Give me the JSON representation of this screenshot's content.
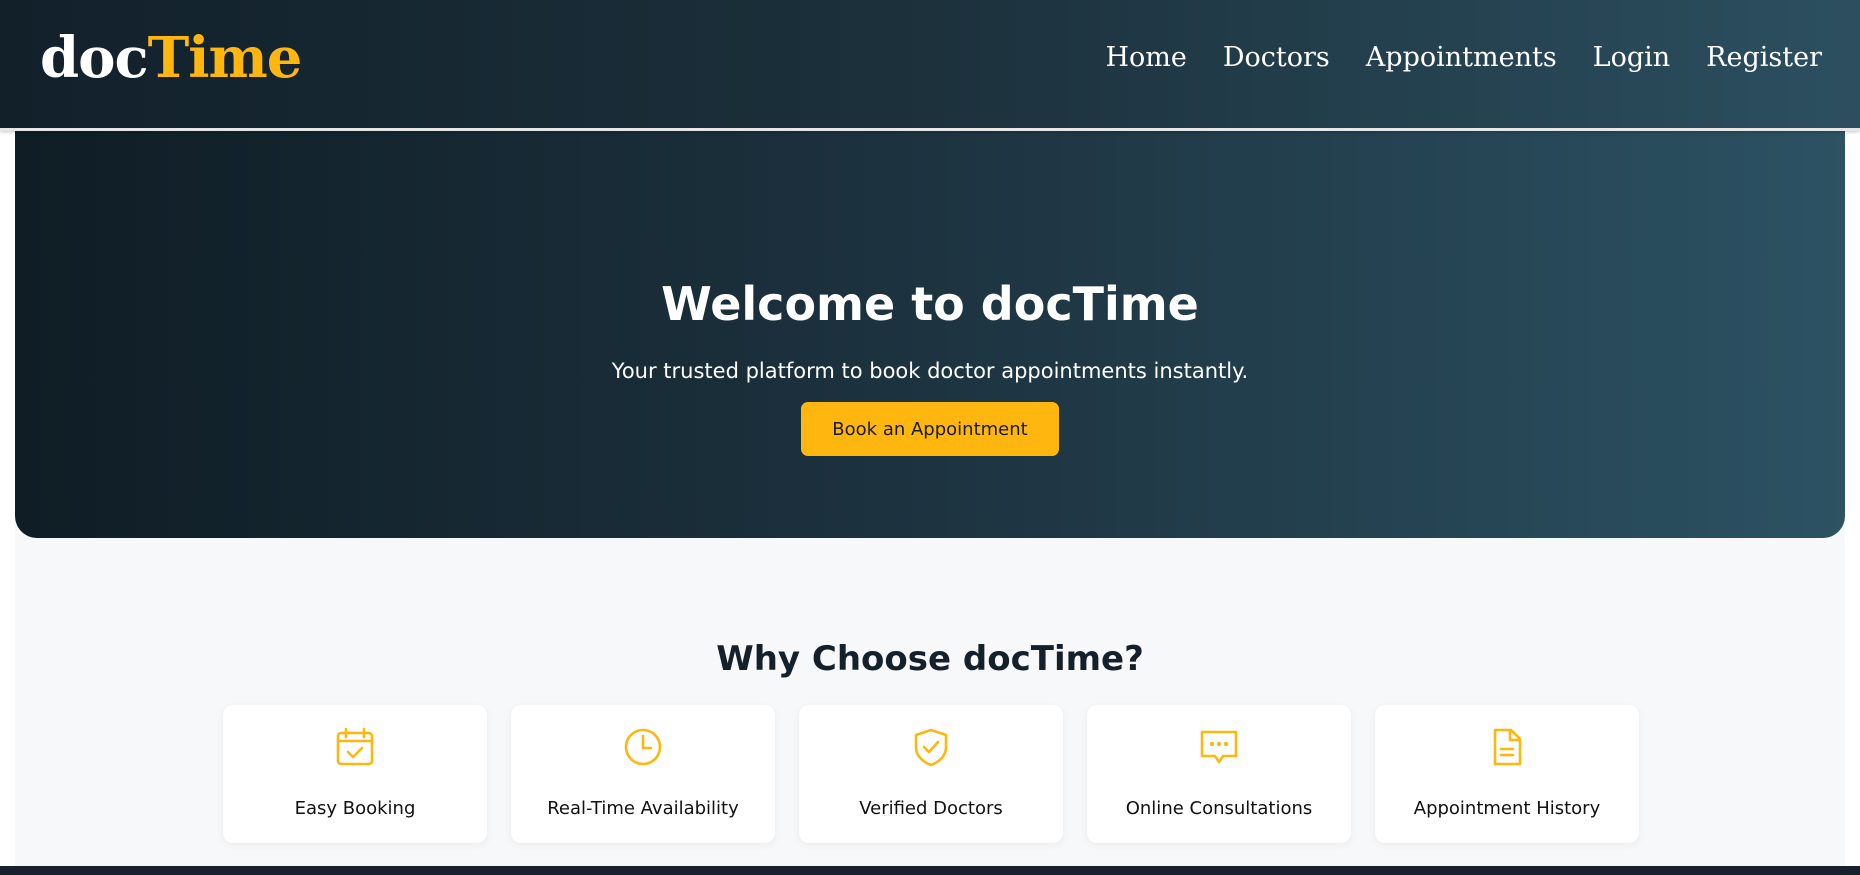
{
  "brand": {
    "part1": "doc",
    "part2": "Time"
  },
  "nav": {
    "items": [
      {
        "label": "Home"
      },
      {
        "label": "Doctors"
      },
      {
        "label": "Appointments"
      },
      {
        "label": "Login"
      },
      {
        "label": "Register"
      }
    ]
  },
  "hero": {
    "title": "Welcome to docTime",
    "subtitle": "Your trusted platform to book doctor appointments instantly.",
    "cta_label": "Book an Appointment"
  },
  "features": {
    "title": "Why Choose docTime?",
    "items": [
      {
        "label": "Easy Booking",
        "icon": "calendar-check-icon"
      },
      {
        "label": "Real-Time Availability",
        "icon": "clock-icon"
      },
      {
        "label": "Verified Doctors",
        "icon": "shield-check-icon"
      },
      {
        "label": "Online Consultations",
        "icon": "chat-bubble-icon"
      },
      {
        "label": "Appointment History",
        "icon": "document-icon"
      }
    ]
  },
  "colors": {
    "accent": "#ffb70f",
    "hero_dark": "#0f1d25",
    "hero_light": "#2c5263"
  }
}
